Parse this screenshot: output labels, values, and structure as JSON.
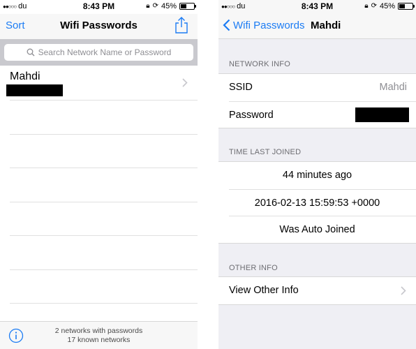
{
  "status_left": {
    "carrier": "du",
    "time": "8:43 PM",
    "battery": "45%",
    "battery_level": 0.45
  },
  "status_right": {
    "carrier": "du",
    "time": "8:43 PM",
    "battery": "45%",
    "battery_level": 0.45
  },
  "list_screen": {
    "nav": {
      "sort_label": "Sort",
      "title": "Wifi Passwords"
    },
    "search": {
      "placeholder": "Search Network Name or Password"
    },
    "networks": [
      {
        "name": "Mahdi"
      }
    ],
    "footer": {
      "line1": "2 networks with passwords",
      "line2": "17 known networks"
    }
  },
  "detail_screen": {
    "nav": {
      "back_label": "Wifi Passwords",
      "title": "Mahdi"
    },
    "network_info": {
      "header": "NETWORK INFO",
      "ssid_label": "SSID",
      "ssid_value": "Mahdi",
      "password_label": "Password"
    },
    "time_last_joined": {
      "header": "TIME LAST JOINED",
      "relative": "44 minutes ago",
      "timestamp": "2016-02-13 15:59:53 +0000",
      "auto_joined": "Was Auto Joined"
    },
    "other_info": {
      "header": "OTHER INFO",
      "view_label": "View Other Info"
    }
  },
  "colors": {
    "accent": "#1c7cf4",
    "group_bg": "#efeff4",
    "search_bar": "#c9c9ce"
  }
}
